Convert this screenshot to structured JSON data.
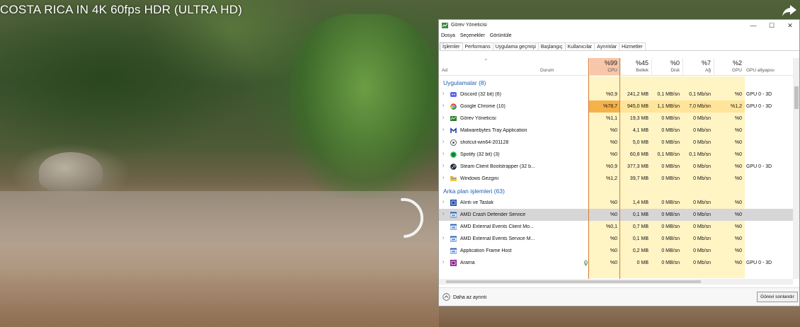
{
  "video": {
    "title": "COSTA RICA IN 4K 60fps HDR (ULTRA HD)",
    "share_icon": "share-arrow-icon",
    "loading_icon": "loading-spinner-icon"
  },
  "task_manager": {
    "title": "Görev Yöneticisi",
    "menu": [
      "Dosya",
      "Seçenekler",
      "Görüntüle"
    ],
    "tabs": [
      "İşlemler",
      "Performans",
      "Uygulama geçmişi",
      "Başlangıç",
      "Kullanıcılar",
      "Ayrıntılar",
      "Hizmetler"
    ],
    "active_tab": "İşlemler",
    "window_buttons": {
      "minimize": "—",
      "maximize": "☐",
      "close": "✕"
    },
    "columns": {
      "name": "Ad",
      "status": "Durum",
      "cpu": {
        "pct": "%99",
        "label": "CPU"
      },
      "memory": {
        "pct": "%45",
        "label": "Bellek"
      },
      "disk": {
        "pct": "%0",
        "label": "Disk"
      },
      "network": {
        "pct": "%7",
        "label": "Ağ"
      },
      "gpu": {
        "pct": "%2",
        "label": "GPU"
      },
      "gpu_engine": "GPU altyapısı"
    },
    "groups": [
      {
        "label": "Uygulamalar (8)",
        "rows": [
          {
            "name": "Discord (32 bit) (6)",
            "icon": "discord-icon",
            "expandable": true,
            "cpu": "%0,9",
            "mem": "241,2 MB",
            "disk": "0,1 MB/sn",
            "net": "0,1 Mb/sn",
            "gpu": "%0",
            "engine": "GPU 0 - 3D"
          },
          {
            "name": "Google Chrome (10)",
            "icon": "chrome-icon",
            "expandable": true,
            "cpu": "%78,7",
            "mem": "945,0 MB",
            "disk": "1,1 MB/sn",
            "net": "7,0 Mb/sn",
            "gpu": "%1,2",
            "engine": "GPU 0 - 3D"
          },
          {
            "name": "Görev Yöneticisi",
            "icon": "task-manager-icon",
            "expandable": true,
            "cpu": "%1,1",
            "mem": "19,3 MB",
            "disk": "0 MB/sn",
            "net": "0 Mb/sn",
            "gpu": "%0",
            "engine": ""
          },
          {
            "name": "Malwarebytes Tray Application",
            "icon": "malwarebytes-icon",
            "expandable": true,
            "cpu": "%0",
            "mem": "4,1 MB",
            "disk": "0 MB/sn",
            "net": "0 Mb/sn",
            "gpu": "%0",
            "engine": ""
          },
          {
            "name": "shotcut-win64-201128",
            "icon": "shotcut-icon",
            "expandable": true,
            "cpu": "%0",
            "mem": "5,0 MB",
            "disk": "0 MB/sn",
            "net": "0 Mb/sn",
            "gpu": "%0",
            "engine": ""
          },
          {
            "name": "Spotify (32 bit) (3)",
            "icon": "spotify-icon",
            "expandable": true,
            "cpu": "%0",
            "mem": "60,8 MB",
            "disk": "0,1 MB/sn",
            "net": "0,1 Mb/sn",
            "gpu": "%0",
            "engine": ""
          },
          {
            "name": "Steam Client Bootstrapper (32 b...",
            "icon": "steam-icon",
            "expandable": true,
            "cpu": "%0,9",
            "mem": "377,3 MB",
            "disk": "0 MB/sn",
            "net": "0 Mb/sn",
            "gpu": "%0",
            "engine": "GPU 0 - 3D"
          },
          {
            "name": "Windows Gezgini",
            "icon": "file-explorer-icon",
            "expandable": true,
            "cpu": "%1,2",
            "mem": "39,7 MB",
            "disk": "0 MB/sn",
            "net": "0 Mb/sn",
            "gpu": "%0",
            "engine": ""
          }
        ]
      },
      {
        "label": "Arka plan işlemleri (63)",
        "rows": [
          {
            "name": "Alıntı ve Taslak",
            "icon": "snip-sketch-icon",
            "expandable": true,
            "cpu": "%0",
            "mem": "1,4 MB",
            "disk": "0 MB/sn",
            "net": "0 Mb/sn",
            "gpu": "%0",
            "engine": ""
          },
          {
            "name": "AMD Crash Defender Service",
            "icon": "service-icon",
            "expandable": true,
            "selected": true,
            "cpu": "%0",
            "mem": "0,1 MB",
            "disk": "0 MB/sn",
            "net": "0 Mb/sn",
            "gpu": "%0",
            "engine": ""
          },
          {
            "name": "AMD External Events Client Mo...",
            "icon": "service-icon",
            "expandable": false,
            "cpu": "%0,1",
            "mem": "0,7 MB",
            "disk": "0 MB/sn",
            "net": "0 Mb/sn",
            "gpu": "%0",
            "engine": ""
          },
          {
            "name": "AMD External Events Service M...",
            "icon": "service-icon",
            "expandable": true,
            "cpu": "%0",
            "mem": "0,1 MB",
            "disk": "0 MB/sn",
            "net": "0 Mb/sn",
            "gpu": "%0",
            "engine": ""
          },
          {
            "name": "Application Frame Host",
            "icon": "service-icon",
            "expandable": false,
            "cpu": "%0",
            "mem": "0,2 MB",
            "disk": "0 MB/sn",
            "net": "0 Mb/sn",
            "gpu": "%0",
            "engine": ""
          },
          {
            "name": "Arama",
            "icon": "search-app-icon",
            "expandable": true,
            "leaf": true,
            "cpu": "%0",
            "mem": "0 MB",
            "disk": "0 MB/sn",
            "net": "0 Mb/sn",
            "gpu": "%0",
            "engine": "GPU 0 - 3D"
          }
        ]
      }
    ],
    "footer": {
      "less_details": "Daha az ayrıntı",
      "end_task": "Görevi sonlandır"
    },
    "colors": {
      "cpu_high": "#f6b24a",
      "cpu_header": "#f8c6a8",
      "column_tint": "#fff4c4",
      "group_blue": "#1a5fb4"
    }
  }
}
